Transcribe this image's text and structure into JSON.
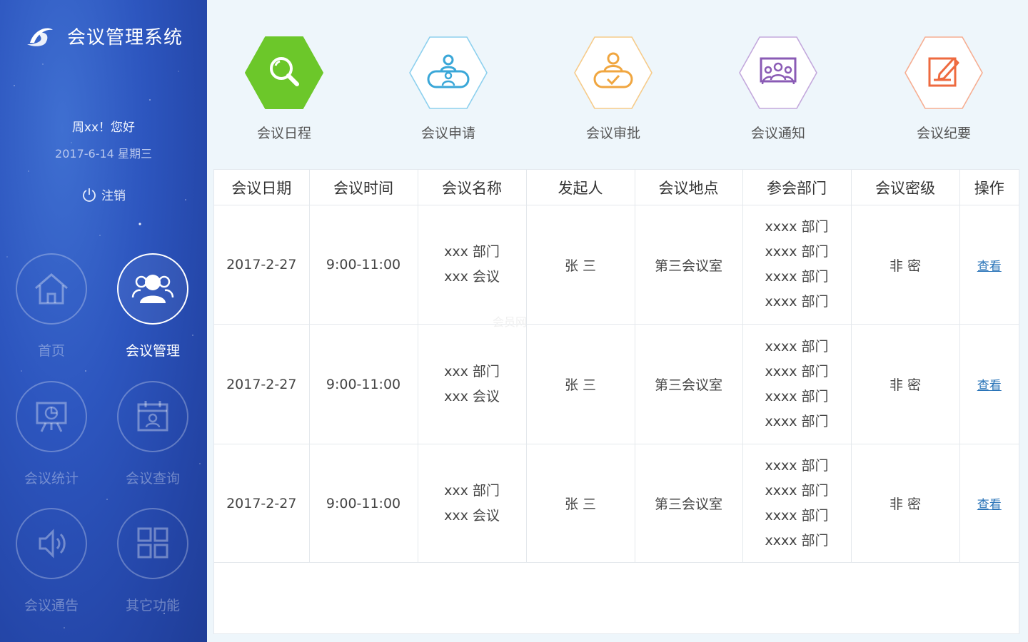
{
  "app": {
    "title": "会议管理系统"
  },
  "user": {
    "greeting": "周xx！您好",
    "date": "2017-6-14   星期三",
    "logout_label": "注销"
  },
  "sidebar": {
    "items": [
      {
        "label": "首页",
        "icon": "home-icon",
        "active": false
      },
      {
        "label": "会议管理",
        "icon": "users-icon",
        "active": true
      },
      {
        "label": "会议统计",
        "icon": "presentation-chart-icon",
        "active": false
      },
      {
        "label": "会议查询",
        "icon": "calendar-person-icon",
        "active": false
      },
      {
        "label": "会议通告",
        "icon": "speaker-icon",
        "active": false
      },
      {
        "label": "其它功能",
        "icon": "grid-icon",
        "active": false
      }
    ]
  },
  "toolbar": {
    "items": [
      {
        "label": "会议日程",
        "icon": "search-icon",
        "color": "#6cc72a",
        "active": true
      },
      {
        "label": "会议申请",
        "icon": "person-apply-icon",
        "color": "#3aa7d8",
        "active": false
      },
      {
        "label": "会议审批",
        "icon": "person-approve-icon",
        "color": "#f0a640",
        "active": false
      },
      {
        "label": "会议通知",
        "icon": "group-notice-icon",
        "color": "#8a5bb5",
        "active": false
      },
      {
        "label": "会议纪要",
        "icon": "edit-notes-icon",
        "color": "#ee6a3f",
        "active": false
      }
    ]
  },
  "table": {
    "columns": [
      "会议日期",
      "会议时间",
      "会议名称",
      "发起人",
      "会议地点",
      "参会部门",
      "会议密级",
      "操作"
    ],
    "rows": [
      {
        "date": "2017-2-27",
        "time": "9:00-11:00",
        "name": [
          "xxx 部门",
          "xxx 会议"
        ],
        "initiator": "张  三",
        "location": "第三会议室",
        "departments": [
          "xxxx 部门",
          "xxxx 部门",
          "xxxx 部门",
          "xxxx 部门"
        ],
        "level": "非  密",
        "action": "查看"
      },
      {
        "date": "2017-2-27",
        "time": "9:00-11:00",
        "name": [
          "xxx 部门",
          "xxx 会议"
        ],
        "initiator": "张  三",
        "location": "第三会议室",
        "departments": [
          "xxxx 部门",
          "xxxx 部门",
          "xxxx 部门",
          "xxxx 部门"
        ],
        "level": "非  密",
        "action": "查看"
      },
      {
        "date": "2017-2-27",
        "time": "9:00-11:00",
        "name": [
          "xxx 部门",
          "xxx 会议"
        ],
        "initiator": "张  三",
        "location": "第三会议室",
        "departments": [
          "xxxx 部门",
          "xxxx 部门",
          "xxxx 部门",
          "xxxx 部门"
        ],
        "level": "非  密",
        "action": "查看"
      }
    ]
  },
  "watermark": "会员网"
}
